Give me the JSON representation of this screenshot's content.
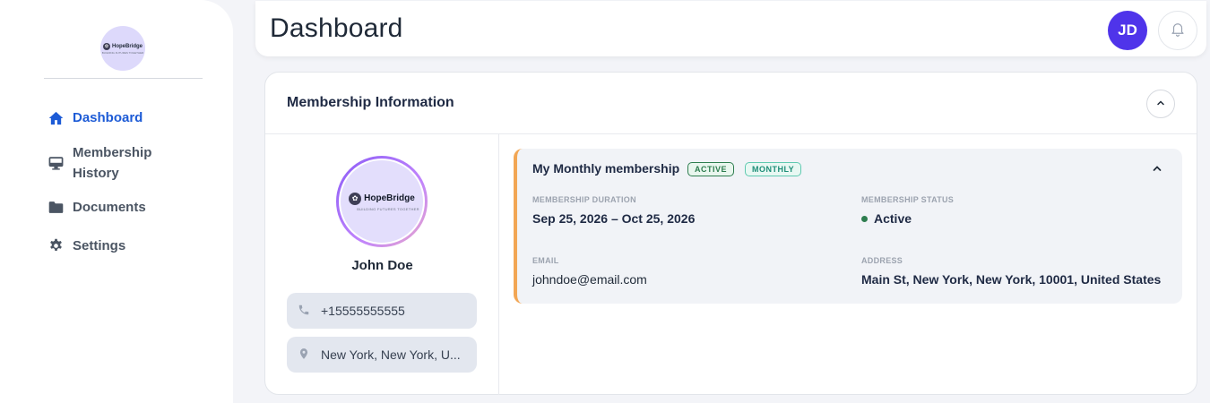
{
  "sidebar": {
    "logo": {
      "name": "HopeBridge",
      "tagline": "BUILDING FUTURES TOGETHER"
    },
    "items": [
      {
        "label": "Dashboard",
        "icon": "home-icon",
        "active": true
      },
      {
        "label": "Membership History",
        "icon": "monitor-icon",
        "active": false
      },
      {
        "label": "Documents",
        "icon": "folder-icon",
        "active": false
      },
      {
        "label": "Settings",
        "icon": "gear-icon",
        "active": false
      }
    ]
  },
  "header": {
    "title": "Dashboard",
    "avatar_initials": "JD",
    "notification_icon": "bell-icon"
  },
  "membership_card": {
    "title": "Membership Information",
    "profile": {
      "logo_name": "HopeBridge",
      "logo_tagline": "BUILDING FUTURES TOGETHER",
      "name": "John Doe",
      "phone": "+15555555555",
      "location": "New York, New York, U..."
    },
    "membership": {
      "plan_name": "My Monthly membership",
      "badges": [
        "ACTIVE",
        "MONTHLY"
      ],
      "duration_label": "MEMBERSHIP DURATION",
      "duration_value": "Sep 25, 2026 – Oct 25, 2026",
      "status_label": "MEMBERSHIP STATUS",
      "status_value": "Active",
      "email_label": "EMAIL",
      "email_value": "johndoe@email.com",
      "address_label": "ADDRESS",
      "address_value": "Main St, New York, New York, 10001, United States"
    }
  },
  "colors": {
    "accent": "#1d5bd6",
    "avatar": "#4f34ea",
    "panel_border": "#f2a654",
    "status_active": "#2e7d4f"
  }
}
